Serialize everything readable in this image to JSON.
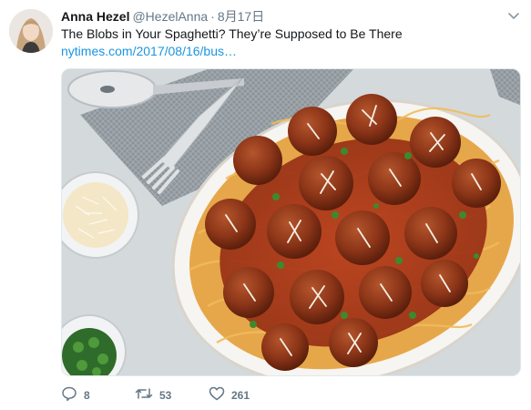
{
  "tweet": {
    "author_name": "Anna Hezel",
    "author_handle": "@HezelAnna",
    "separator": "·",
    "date": "8月17日",
    "text": "The Blobs in Your Spaghetti? They’re Supposed to Be There",
    "link_text": "nytimes.com/2017/08/16/bus…",
    "media_description_icon": "photo-spaghetti-meatballs",
    "reply_count": "8",
    "retweet_count": "53",
    "like_count": "261"
  },
  "icons": {
    "more": "chevron-down-icon",
    "reply": "reply-icon",
    "retweet": "retweet-icon",
    "like": "heart-icon"
  },
  "colors": {
    "text": "#14171a",
    "secondary": "#657786",
    "link": "#1b95e0"
  }
}
